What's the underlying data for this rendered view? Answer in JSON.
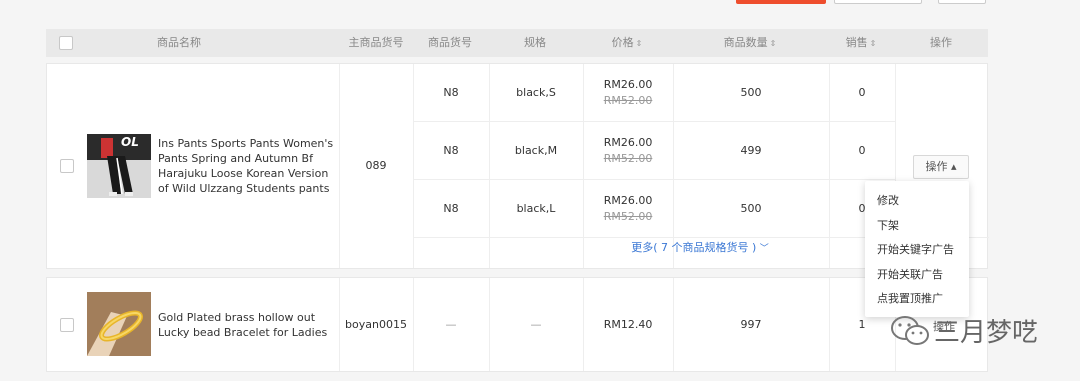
{
  "table": {
    "headers": {
      "name": "商品名称",
      "main_sku": "主商品货号",
      "sku": "商品货号",
      "spec": "规格",
      "price": "价格",
      "qty": "商品数量",
      "sales": "销售",
      "actions": "操作"
    },
    "sort_icon": "⇕"
  },
  "products": [
    {
      "name": "Ins Pants Sports Pants Women's Pants Spring and Autumn Bf Harajuku Loose Korean Version of Wild Ulzzang Students pants",
      "main_sku": "089",
      "variants": [
        {
          "sku": "N8",
          "spec": "black,S",
          "price": "RM26.00",
          "orig_price": "RM52.00",
          "qty": "500",
          "sales": "0"
        },
        {
          "sku": "N8",
          "spec": "black,M",
          "price": "RM26.00",
          "orig_price": "RM52.00",
          "qty": "499",
          "sales": "0"
        },
        {
          "sku": "N8",
          "spec": "black,L",
          "price": "RM26.00",
          "orig_price": "RM52.00",
          "qty": "500",
          "sales": "0"
        }
      ],
      "more_link": "更多( 7 个商品规格货号 )",
      "action_label": "操作 ▴"
    },
    {
      "name": "Gold Plated brass hollow out Lucky bead Bracelet for Ladies",
      "main_sku": "boyan0015",
      "sku": "—",
      "spec": "—",
      "price": "RM12.40",
      "qty": "997",
      "sales": "1",
      "action_label": "操作"
    }
  ],
  "dropdown": {
    "items": [
      "修改",
      "下架",
      "开始关键字广告",
      "开始关联广告",
      "点我置顶推广"
    ]
  },
  "watermark": {
    "text": "三月梦呓",
    "icon": "wechat-icon"
  },
  "colors": {
    "link": "#3a77d4",
    "brand": "#ee4d2d"
  }
}
